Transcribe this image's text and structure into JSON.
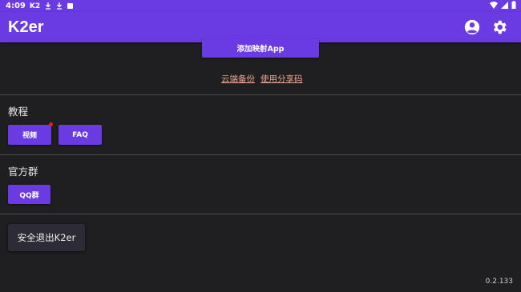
{
  "status_bar": {
    "time": "4:09",
    "app_indicator": "K2"
  },
  "app_bar": {
    "title": "K2er",
    "account_icon": "account-circle-icon",
    "settings_icon": "gear-icon"
  },
  "top_section": {
    "add_mapping_app_label": "添加映射App",
    "cloud_backup_link": "云端备份",
    "share_code_link": "使用分享码"
  },
  "tutorial_section": {
    "title": "教程",
    "video_label": "视频",
    "faq_label": "FAQ"
  },
  "group_section": {
    "title": "官方群",
    "qq_group_label": "QQ群"
  },
  "exit_label": "安全退出K2er",
  "version": "0.2.133",
  "colors": {
    "accent": "#6a3ae2",
    "background": "#1f1e21",
    "link": "#e7a793"
  }
}
